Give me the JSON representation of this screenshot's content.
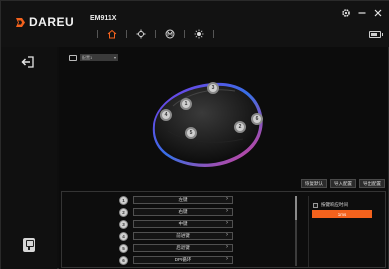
{
  "brand": {
    "name": "DAREU"
  },
  "device": {
    "model": "EM911X"
  },
  "nav": {
    "items": [
      {
        "icon": "home-icon",
        "active": true
      },
      {
        "icon": "crosshair-icon",
        "active": false
      },
      {
        "icon": "macro-icon",
        "active": false
      },
      {
        "icon": "light-icon",
        "active": false
      }
    ]
  },
  "window": {
    "controls": [
      "gear-icon",
      "minimize-icon",
      "close-icon"
    ]
  },
  "battery": {
    "level": 0.7
  },
  "profile": {
    "selected": "配置1"
  },
  "mouse": {
    "hotspots": [
      "1",
      "2",
      "3",
      "4",
      "5",
      "6"
    ]
  },
  "actions": {
    "restore": "恢复默认",
    "import": "导入配置",
    "export": "导出配置"
  },
  "keys": [
    {
      "num": "1",
      "label": "左键"
    },
    {
      "num": "2",
      "label": "右键"
    },
    {
      "num": "3",
      "label": "中键"
    },
    {
      "num": "4",
      "label": "前进键"
    },
    {
      "num": "5",
      "label": "后退键"
    },
    {
      "num": "6",
      "label": "DPI循环"
    }
  ],
  "macro": {
    "check_label": "按键响应时间",
    "value": "1ms"
  },
  "colors": {
    "accent": "#f3621d",
    "background": "#0e0e0e",
    "text": "#dddddd"
  }
}
